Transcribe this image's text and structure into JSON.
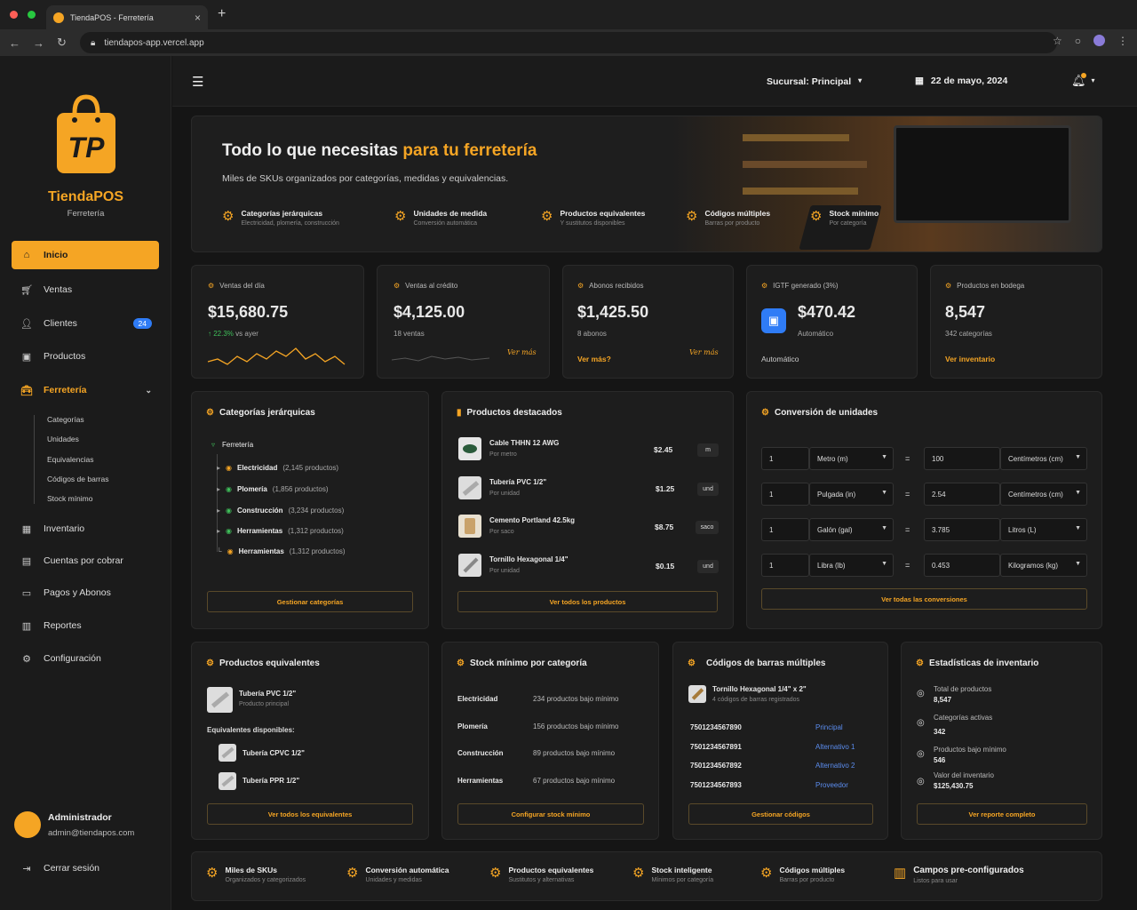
{
  "browser": {
    "tab_title": "TiendaPOS - Ferretería",
    "url": "tiendapos-app.vercel.app",
    "new_tab": "+",
    "close": "×"
  },
  "sidebar": {
    "brand": "TiendaPOS",
    "brand_sub": "Ferretería",
    "logo_letters": "TP",
    "items": [
      {
        "label": "Inicio",
        "icon": "home-icon"
      },
      {
        "label": "Ventas",
        "icon": "cart-icon"
      },
      {
        "label": "Clientes",
        "icon": "users-icon",
        "badge": "24"
      },
      {
        "label": "Productos",
        "icon": "box-icon"
      },
      {
        "label": "Ferretería",
        "icon": "toolbox-icon"
      },
      {
        "label": "Inventario",
        "icon": "inventory-icon"
      },
      {
        "label": "Cuentas por cobrar",
        "icon": "receipt-icon"
      },
      {
        "label": "Pagos y Abonos",
        "icon": "wallet-icon"
      },
      {
        "label": "Reportes",
        "icon": "report-icon"
      },
      {
        "label": "Configuración",
        "icon": "gear-icon"
      }
    ],
    "subitems": [
      "Categorías",
      "Unidades",
      "Equivalencias",
      "Códigos de barras",
      "Stock mínimo"
    ],
    "user_name": "Administrador",
    "user_email": "admin@tiendapos.com",
    "logout": "Cerrar sesión"
  },
  "topbar": {
    "branch": "Sucursal: Principal",
    "date": "22 de mayo, 2024"
  },
  "hero": {
    "title_a": "Todo lo que necesitas ",
    "title_b": "para tu ferretería",
    "subtitle": "Miles de SKUs organizados por categorías, medidas y equivalencias.",
    "features": [
      {
        "title": "Categorías jerárquicas",
        "sub": "Electricidad, plomería, construcción"
      },
      {
        "title": "Unidades de medida",
        "sub": "Conversión automática"
      },
      {
        "title": "Productos equivalentes",
        "sub": "Y sustitutos disponibles"
      },
      {
        "title": "Códigos múltiples",
        "sub": "Barras por producto"
      },
      {
        "title": "Stock mínimo",
        "sub": "Por categoría"
      }
    ]
  },
  "kpis": [
    {
      "label": "Ventas del día",
      "value": "$15,680.75",
      "delta": "↑ 22.3%",
      "delta_sub": "vs ayer"
    },
    {
      "label": "Ventas al crédito",
      "value": "$4,125.00",
      "sub": "18 ventas",
      "sig": "Ver más"
    },
    {
      "label": "Abonos recibidos",
      "value": "$1,425.50",
      "sub": "8 abonos",
      "link": "Ver más?",
      "sig": "Ver más"
    },
    {
      "label": "IGTF generado (3%)",
      "value": "$470.42",
      "sub": "Automático",
      "foot": "Automático"
    },
    {
      "label": "Productos en bodega",
      "value": "8,547",
      "sub": "342 categorías",
      "link": "Ver inventario"
    }
  ],
  "categories": {
    "title": "Categorías jerárquicas",
    "root": "Ferretería",
    "items": [
      {
        "name": "Electricidad",
        "count": "(2,145 productos)"
      },
      {
        "name": "Plomería",
        "count": "(1,856 productos)"
      },
      {
        "name": "Construcción",
        "count": "(3,234 productos)"
      },
      {
        "name": "Herramientas",
        "count": "(1,312 productos)"
      },
      {
        "name": "Herramientas",
        "count": "(1,312 productos)"
      }
    ],
    "button": "Gestionar categorías"
  },
  "featured": {
    "title": "Productos destacados",
    "items": [
      {
        "name": "Cable THHN 12 AWG",
        "sub": "Por metro",
        "price": "$2.45",
        "unit": "m"
      },
      {
        "name": "Tubería PVC 1/2\"",
        "sub": "Por unidad",
        "price": "$1.25",
        "unit": "und"
      },
      {
        "name": "Cemento Portland 42.5kg",
        "sub": "Por saco",
        "price": "$8.75",
        "unit": "saco"
      },
      {
        "name": "Tornillo Hexagonal 1/4\"",
        "sub": "Por unidad",
        "price": "$0.15",
        "unit": "und"
      }
    ],
    "button": "Ver todos los productos"
  },
  "conversion": {
    "title": "Conversión de unidades",
    "rows": [
      {
        "qty": "1",
        "from": "Metro (m)",
        "result": "100",
        "to": "Centímetros (cm)"
      },
      {
        "qty": "1",
        "from": "Pulgada (in)",
        "result": "2.54",
        "to": "Centímetros (cm)"
      },
      {
        "qty": "1",
        "from": "Galón (gal)",
        "result": "3.785",
        "to": "Litros (L)"
      },
      {
        "qty": "1",
        "from": "Libra (lb)",
        "result": "0.453",
        "to": "Kilogramos (kg)"
      }
    ],
    "eq": "=",
    "button": "Ver todas las conversiones"
  },
  "equivalents": {
    "title": "Productos equivalentes",
    "main_name": "Tubería PVC 1/2\"",
    "main_sub": "Producto principal",
    "avail_label": "Equivalentes disponibles:",
    "items": [
      "Tubería CPVC 1/2\"",
      "Tubería PPR 1/2\""
    ],
    "button": "Ver todos los equivalentes"
  },
  "stock": {
    "title": "Stock mínimo por categoría",
    "rows": [
      {
        "cat": "Electricidad",
        "text": "234 productos bajo mínimo"
      },
      {
        "cat": "Plomería",
        "text": "156 productos bajo mínimo"
      },
      {
        "cat": "Construcción",
        "text": "89 productos bajo mínimo"
      },
      {
        "cat": "Herramientas",
        "text": "67 productos bajo mínimo"
      }
    ],
    "button": "Configurar stock mínimo"
  },
  "barcodes": {
    "title": "Códigos de barras múltiples",
    "product": "Tornillo Hexagonal 1/4\" x 2\"",
    "product_sub": "4 códigos de barras registrados",
    "rows": [
      {
        "code": "7501234567890",
        "type": "Principal"
      },
      {
        "code": "7501234567891",
        "type": "Alternativo 1"
      },
      {
        "code": "7501234567892",
        "type": "Alternativo 2"
      },
      {
        "code": "7501234567893",
        "type": "Proveedor"
      }
    ],
    "button": "Gestionar códigos"
  },
  "stats": {
    "title": "Estadísticas de inventario",
    "rows": [
      {
        "label": "Total de productos",
        "value": "8,547"
      },
      {
        "label": "Categorías activas",
        "value": "342"
      },
      {
        "label": "Productos bajo mínimo",
        "value": "546"
      },
      {
        "label": "Valor del inventario",
        "value": "$125,430.75"
      }
    ],
    "button": "Ver reporte completo"
  },
  "footer_features": [
    {
      "title": "Miles de SKUs",
      "sub": "Organizados y categorizados"
    },
    {
      "title": "Conversión automática",
      "sub": "Unidades y medidas"
    },
    {
      "title": "Productos equivalentes",
      "sub": "Sustitutos y alternativas"
    },
    {
      "title": "Stock inteligente",
      "sub": "Mínimos por categoría"
    },
    {
      "title": "Códigos múltiples",
      "sub": "Barras por producto"
    },
    {
      "title": "Campos pre-configurados",
      "sub": "Listos para usar"
    }
  ],
  "colors": {
    "accent": "#f5a524",
    "link_blue": "#5b8def",
    "badge_blue": "#2f7cf6",
    "green": "#3fbf5a"
  },
  "sales_trend": [
    5,
    6,
    4,
    7,
    5,
    8,
    6,
    9,
    7,
    10,
    6,
    8,
    5,
    7,
    4
  ]
}
